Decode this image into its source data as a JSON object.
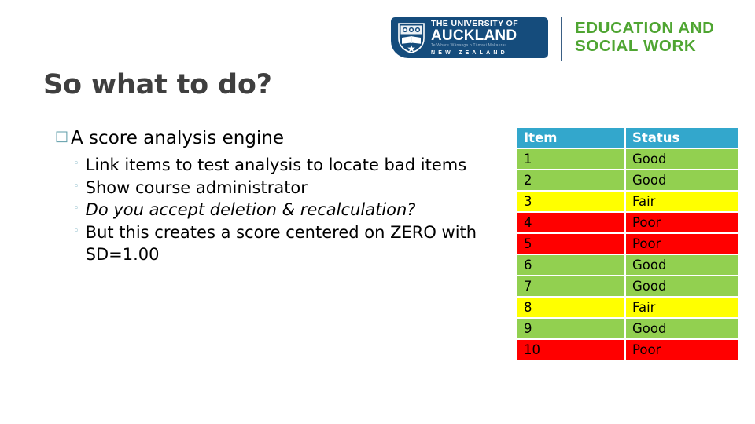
{
  "logo": {
    "university": {
      "line_the": "THE UNIVERSITY OF",
      "line_name": "AUCKLAND",
      "line_maori": "Te Whare Wānanga o Tāmaki Makaurau",
      "line_country": "NEW ZEALAND",
      "crest_icon": "university-crest-icon",
      "background_color": "#154C7C"
    },
    "faculty": {
      "line1": "EDUCATION AND",
      "line2": "SOCIAL WORK",
      "color": "#4FA532"
    }
  },
  "slide": {
    "title": "So what to do?"
  },
  "bullets": {
    "level1_marker": "□",
    "level2_marker": "◦",
    "level1_text": "A score analysis engine",
    "level2_items": [
      {
        "text": "Link items to test analysis to locate bad items",
        "italic": false
      },
      {
        "text": "Show course administrator",
        "italic": false
      },
      {
        "text": "Do you accept deletion & recalculation?",
        "italic": true
      },
      {
        "text": "But this creates a score centered on ZERO with SD=1.00",
        "italic": false
      }
    ]
  },
  "table": {
    "headers": [
      "Item",
      "Status"
    ],
    "header_bg": "#33A7CC",
    "status_colors": {
      "Good": "#92D050",
      "Fair": "#FFFF00",
      "Poor": "#FF0000"
    },
    "rows": [
      {
        "item": "1",
        "status": "Good"
      },
      {
        "item": "2",
        "status": "Good"
      },
      {
        "item": "3",
        "status": "Fair"
      },
      {
        "item": "4",
        "status": "Poor"
      },
      {
        "item": "5",
        "status": "Poor"
      },
      {
        "item": "6",
        "status": "Good"
      },
      {
        "item": "7",
        "status": "Good"
      },
      {
        "item": "8",
        "status": "Fair"
      },
      {
        "item": "9",
        "status": "Good"
      },
      {
        "item": "10",
        "status": "Poor"
      }
    ]
  }
}
